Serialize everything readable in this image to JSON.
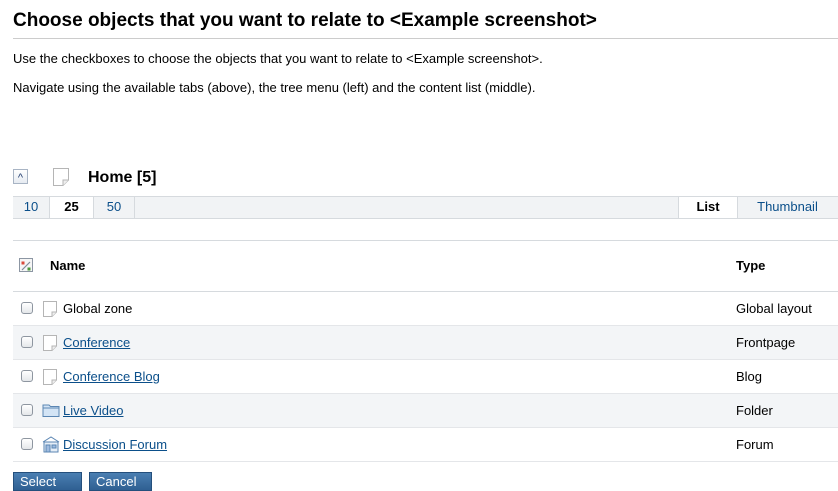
{
  "page": {
    "title": "Choose objects that you want to relate to <Example screenshot>",
    "description_1": "Use the checkboxes to choose the objects that you want to relate to <Example screenshot>.",
    "description_2": "Navigate using the available tabs (above), the tree menu (left) and the content list (middle)."
  },
  "node": {
    "up_icon": "chevron-up-icon",
    "icon": "document-icon",
    "title": "Home [5]"
  },
  "toolbar": {
    "limits": [
      "10",
      "25",
      "50"
    ],
    "active_limit": "25",
    "views": [
      "List",
      "Thumbnail"
    ],
    "active_view": "List"
  },
  "table": {
    "headers": {
      "name": "Name",
      "type": "Type"
    },
    "rows": [
      {
        "name": "Global zone",
        "type": "Global layout",
        "icon": "document-icon",
        "link": false,
        "checked": false
      },
      {
        "name": "Conference",
        "type": "Frontpage",
        "icon": "document-icon",
        "link": true,
        "checked": false
      },
      {
        "name": "Conference Blog",
        "type": "Blog",
        "icon": "document-icon",
        "link": true,
        "checked": false
      },
      {
        "name": "Live Video",
        "type": "Folder",
        "icon": "folder-icon",
        "link": true,
        "checked": false
      },
      {
        "name": "Discussion Forum",
        "type": "Forum",
        "icon": "forum-icon",
        "link": true,
        "checked": false
      }
    ]
  },
  "buttons": {
    "select": "Select",
    "cancel": "Cancel"
  },
  "colors": {
    "link": "#0b4f8a",
    "button": "#3a6ea5"
  }
}
